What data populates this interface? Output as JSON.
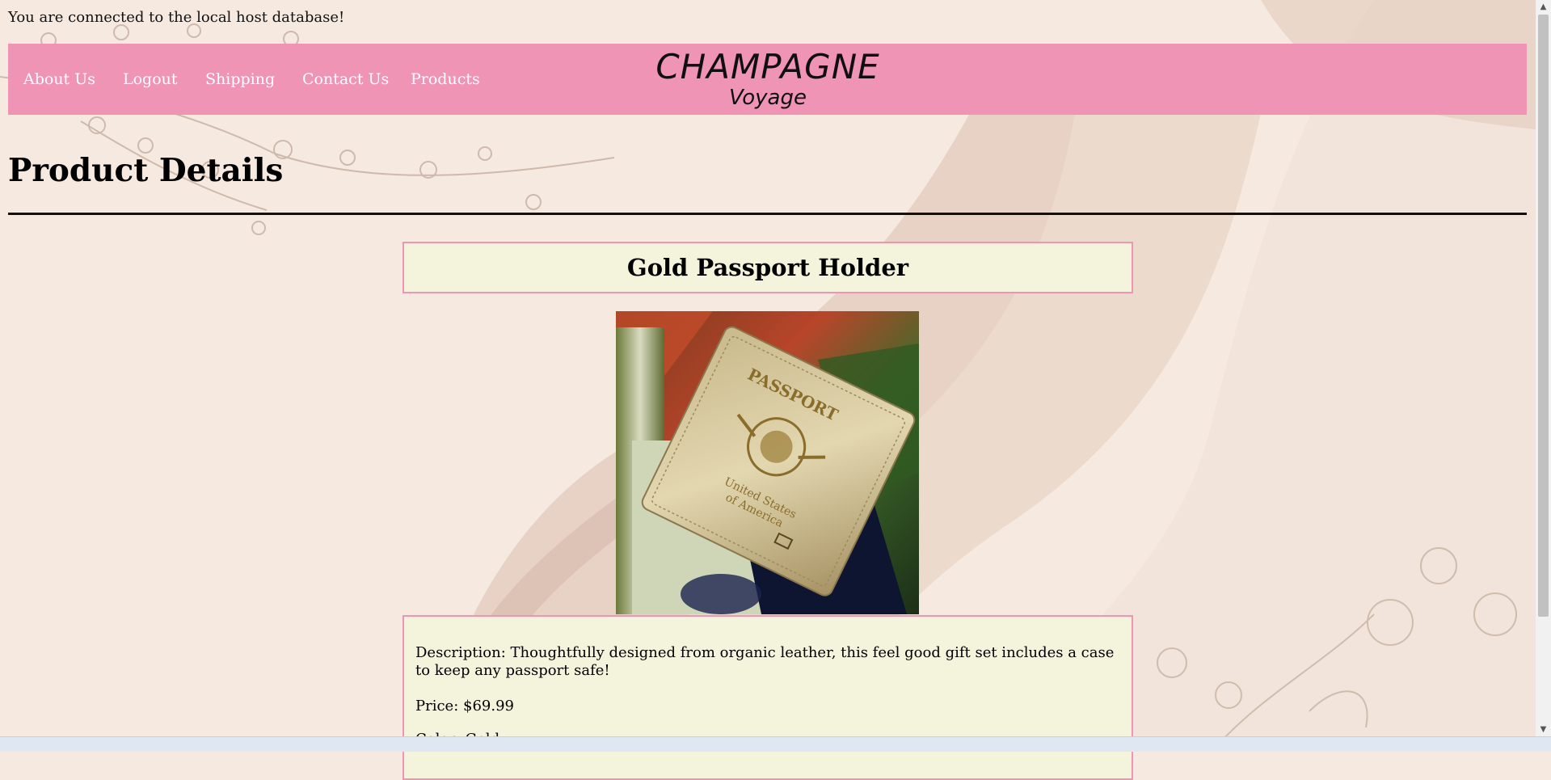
{
  "connection_message": "You are connected to the local host database!",
  "nav": {
    "items": [
      {
        "label": "About Us"
      },
      {
        "label": "Logout"
      },
      {
        "label": "Shipping"
      },
      {
        "label": "Contact Us"
      },
      {
        "label": "Products"
      }
    ],
    "logo_main": "CHAMPAGNE",
    "logo_sub": "Voyage",
    "background_color": "#f094b6"
  },
  "page": {
    "title": "Product Details"
  },
  "product": {
    "name": "Gold Passport Holder",
    "description": "Description: Thoughtfully designed from organic leather, this feel good gift set includes a case to keep any passport safe!",
    "price": "Price: $69.99",
    "color": "Color: Gold",
    "image_text": {
      "passport": "PASSPORT",
      "country_line1": "United States",
      "country_line2": "of America"
    }
  },
  "colors": {
    "accent_pink": "#f094b6",
    "box_background": "#f4f3dc",
    "page_background": "#f5e9e0"
  },
  "icons": [
    "scroll-up-arrow-icon",
    "scroll-down-arrow-icon"
  ]
}
